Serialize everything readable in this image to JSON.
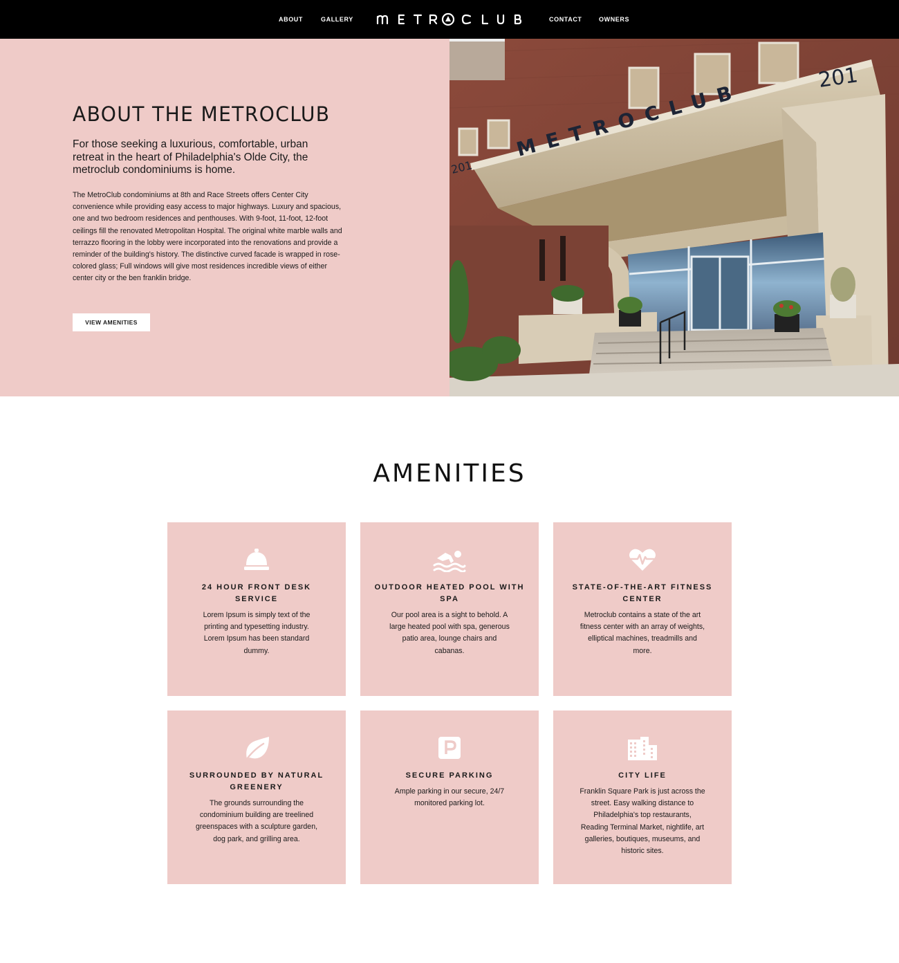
{
  "nav": {
    "about": "ABOUT",
    "gallery": "GALLERY",
    "logo": "METROCLUB",
    "contact": "CONTACT",
    "owners": "OWNERS"
  },
  "about": {
    "title": "ABOUT THE METROCLUB",
    "lead": "For those seeking a luxurious, comfortable, urban retreat in the heart of Philadelphia's Olde City, the metroclub condominiums is home.",
    "body": "The MetroClub condominiums at 8th and Race Streets offers Center City convenience while providing easy access to major highways. Luxury and spacious, one and two bedroom residences and penthouses. With 9-foot, 11-foot, 12-foot ceilings fill the renovated Metropolitan Hospital. The original white marble walls and terrazzo flooring in the lobby were incorporated into the renovations and provide a reminder of the building's history. The distinctive curved facade is wrapped in rose-colored glass; Full windows will give most residences incredible views of either center city or the ben franklin bridge.",
    "button": "VIEW AMENITIES"
  },
  "photo": {
    "sign": "METROCLUB",
    "number_top": "201",
    "number_side": "201"
  },
  "amenities": {
    "title": "AMENITIES",
    "cards": [
      {
        "icon": "bell-icon",
        "title": "24 HOUR FRONT DESK SERVICE",
        "text": "Lorem Ipsum is simply text of the printing and typesetting industry. Lorem Ipsum has been standard dummy."
      },
      {
        "icon": "swimmer-icon",
        "title": "OUTDOOR HEATED POOL WITH SPA",
        "text": "Our pool area is a sight to behold. A large heated pool with spa, generous patio area, lounge chairs and cabanas."
      },
      {
        "icon": "heartbeat-icon",
        "title": "STATE-OF-THE-ART FITNESS CENTER",
        "text": "Metroclub contains a state of the art fitness center with an array of weights, elliptical machines, treadmills and more."
      },
      {
        "icon": "leaf-icon",
        "title": "SURROUNDED BY NATURAL GREENERY",
        "text": "The grounds surrounding the condominium building are treelined greenspaces with a sculpture garden, dog park, and grilling area."
      },
      {
        "icon": "parking-icon",
        "title": "SECURE PARKING",
        "text": "Ample parking in our secure, 24/7 monitored parking lot."
      },
      {
        "icon": "city-icon",
        "title": "CITY LIFE",
        "text": "Franklin Square Park is just across the street. Easy walking distance to Philadelphia's top restaurants, Reading Terminal Market, nightlife, art galleries, boutiques, museums, and historic sites."
      }
    ]
  },
  "colors": {
    "nav_bg": "#000000",
    "pink": "#efcbc8",
    "text": "#1a1a1a"
  }
}
